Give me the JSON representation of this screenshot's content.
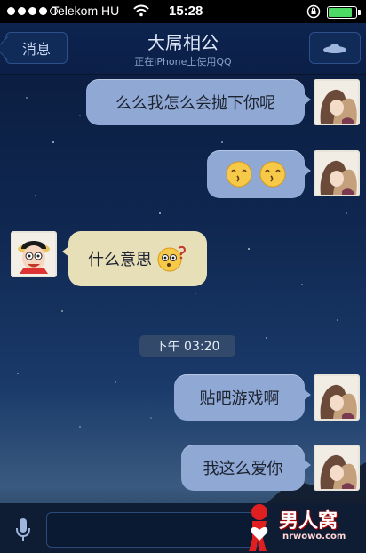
{
  "status_bar": {
    "carrier": "Telekom HU",
    "time": "15:28",
    "battery_level": 0.9
  },
  "nav": {
    "back_label": "消息",
    "title": "大屌相公",
    "subtitle": "正在iPhone上使用QQ",
    "right_icon": "ufo-icon"
  },
  "messages": [
    {
      "side": "out",
      "text": "么么我怎么会抛下你呢"
    },
    {
      "side": "out",
      "text": "",
      "emoji": [
        "smile-emoji",
        "smile-emoji"
      ]
    },
    {
      "side": "in",
      "text": "什么意思",
      "emoji": [
        "confused-emoji"
      ]
    },
    {
      "side": "out",
      "text": "贴吧游戏啊"
    },
    {
      "side": "out",
      "text": "我这么爱你"
    }
  ],
  "timestamp": "下午 03:20",
  "input": {
    "mic_icon": "microphone-icon",
    "placeholder": ""
  },
  "watermark": {
    "text": "男人窝",
    "url": "nrwowo.com"
  },
  "colors": {
    "out_bubble": "#8fa8d4",
    "in_bubble": "#e7dfb8",
    "nav_bg": "#0d2450"
  }
}
